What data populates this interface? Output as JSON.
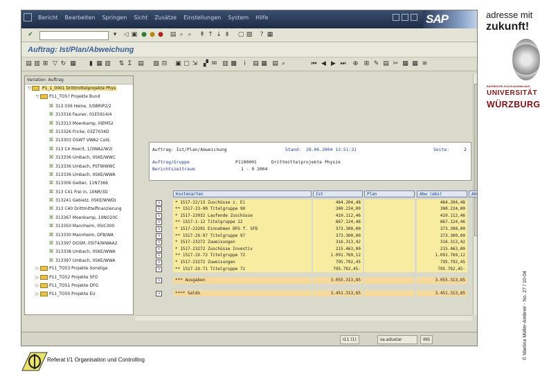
{
  "menu": {
    "items": [
      "Bericht",
      "Bearbeiten",
      "Springen",
      "Sicht",
      "Zusätze",
      "Einstellungen",
      "System",
      "Hilfe"
    ],
    "brand": "SAP"
  },
  "title": "Auftrag: Ist/Plan/Abweichung",
  "tree": {
    "header": "Variation: Auftrag",
    "rows": [
      {
        "indent": 0,
        "tw": "▽",
        "kind": "folder",
        "text": "P1_1_0001 Drittmittelprojekte Phys",
        "selected": true
      },
      {
        "indent": 1,
        "tw": "▽",
        "kind": "folder",
        "text": "P11_TO5? Projekte Bund",
        "selected": false
      },
      {
        "indent": 2,
        "tw": "",
        "kind": "leaf",
        "text": "313 036 Heine, 3/SBRIP2/2",
        "selected": false
      },
      {
        "indent": 2,
        "tw": "",
        "kind": "leaf",
        "text": "313316 Fauner, 01E5914/4",
        "selected": false
      },
      {
        "indent": 2,
        "tw": "",
        "kind": "leaf",
        "text": "313313 Moenkamp, 0IEM52",
        "selected": false
      },
      {
        "indent": 2,
        "tw": "",
        "kind": "leaf",
        "text": "313326 Fricke, 03Z7034D",
        "selected": false
      },
      {
        "indent": 2,
        "tw": "",
        "kind": "leaf",
        "text": "313303 OSWT VWA2 Cold,",
        "selected": false
      },
      {
        "indent": 2,
        "tw": "",
        "kind": "leaf",
        "text": "313 C4 Hoer/t, 1/3WA2/W2I",
        "selected": false
      },
      {
        "indent": 2,
        "tw": "",
        "kind": "leaf",
        "text": "313336 Umbach, 0SKE/WWC",
        "selected": false
      },
      {
        "indent": 2,
        "tw": "",
        "kind": "leaf",
        "text": "313336 Umbach, PSTWWWC",
        "selected": false
      },
      {
        "indent": 2,
        "tw": "",
        "kind": "leaf",
        "text": "313336 Umbach, 0SKE/WWA",
        "selected": false
      },
      {
        "indent": 2,
        "tw": "",
        "kind": "leaf",
        "text": "313306 Geiber, 11N7366",
        "selected": false
      },
      {
        "indent": 2,
        "tw": "",
        "kind": "leaf",
        "text": "313 C41 Frei in, 10NR/3D",
        "selected": false
      },
      {
        "indent": 2,
        "tw": "",
        "kind": "leaf",
        "text": "313241 Gebietz, 0SKE/WWDI",
        "selected": false
      },
      {
        "indent": 2,
        "tw": "",
        "kind": "leaf",
        "text": "313 C40 Drittmittelfinanzierung",
        "selected": false
      },
      {
        "indent": 2,
        "tw": "",
        "kind": "leaf",
        "text": "313367 Moenkamp, 10NO20C",
        "selected": false
      },
      {
        "indent": 2,
        "tw": "",
        "kind": "leaf",
        "text": "313350 Mannheim, 05IC300",
        "selected": false
      },
      {
        "indent": 2,
        "tw": "",
        "kind": "leaf",
        "text": "313330 Mannheim, DFB/WA",
        "selected": false
      },
      {
        "indent": 2,
        "tw": "",
        "kind": "leaf",
        "text": "313397 DGSM, 0SIT4/WWAA2",
        "selected": false
      },
      {
        "indent": 2,
        "tw": "",
        "kind": "leaf",
        "text": "313338 Umbach, 0SKE/WWA",
        "selected": false
      },
      {
        "indent": 2,
        "tw": "",
        "kind": "leaf",
        "text": "313397 Umbach, 0SKE/WWA",
        "selected": false
      },
      {
        "indent": 1,
        "tw": "▷",
        "kind": "folder",
        "text": "P11_TO53 Projekte Sonstige",
        "selected": false
      },
      {
        "indent": 1,
        "tw": "▷",
        "kind": "folder",
        "text": "P11_TO52 Projekte SFO",
        "selected": false
      },
      {
        "indent": 1,
        "tw": "▷",
        "kind": "folder",
        "text": "P11_TO51 Projekte DFG",
        "selected": false
      },
      {
        "indent": 1,
        "tw": "▷",
        "kind": "folder",
        "text": "P11_TO50 Projekte EU",
        "selected": false
      }
    ]
  },
  "report": {
    "header_title": "Auftrag: Ist/Plan/Abweichung",
    "stand_label": "Stand:",
    "stand_value": "28.06.2004 13:51:31",
    "seite_label": "Seite:",
    "seite_value": "2",
    "auftragsgruppe_label": "Auftrag/Gruppe",
    "auftragsgruppe_value": "P1100001",
    "auftragsgruppe_desc": "Drittmittelprojekte Physik",
    "berichtszeitraum_label": "Berichtszeitraum",
    "berichtszeitraum_value": "1 - 9 2004",
    "columns": [
      "Kostenarten",
      "Ist",
      "Plan",
      "Abw (abs)",
      "Abw"
    ],
    "rows": [
      {
        "kostenart": "*     1517-22/13 Zuschüsse z. Ei",
        "ist": "464.204,48",
        "plan": "",
        "abw": "464.204,48"
      },
      {
        "kostenart": "**       1517-23-90 Titelgruppe 90",
        "ist": "300.224,00",
        "plan": "",
        "abw": "300.224,00"
      },
      {
        "kostenart": "*     1517-23932 Laufende Zuschüsse",
        "ist": "410.112,46",
        "plan": "",
        "abw": "410.112,46"
      },
      {
        "kostenart": "**       1517-1-12 Titelgruppe 12",
        "ist": "867.124,46",
        "plan": "",
        "abw": "867.124,46"
      },
      {
        "kostenart": "*     1517-23291 Einnahmen DFG f. SFD",
        "ist": "373.300,00",
        "plan": "",
        "abw": "373.300,00"
      },
      {
        "kostenart": "**       1517-2X-97 Titelgruppe 97",
        "ist": "373.300,00",
        "plan": "",
        "abw": "373.300,00"
      },
      {
        "kostenart": "*     1517-23272 Zuweisungen",
        "ist": "316.313,42",
        "plan": "",
        "abw": "316.313,42"
      },
      {
        "kostenart": "*     1517-23272 Zuschüsse Investiv",
        "ist": "215.463,00",
        "plan": "",
        "abw": "215.463,00"
      },
      {
        "kostenart": "**       1517-2X-72 Titelgruppe 72",
        "ist": "1.091.769,12",
        "plan": "",
        "abw": "1.091.769,12"
      },
      {
        "kostenart": "*     1517-23272 Zuweisungen",
        "ist": "795.792,45",
        "plan": "",
        "abw": "795.792,45"
      },
      {
        "kostenart": "**       1517-2X-71 Titelgruppe 71",
        "ist": "795.792,45-",
        "plan": "",
        "abw": "795.792,45-"
      }
    ],
    "totals": [
      {
        "kostenart": "***      Ausgaben",
        "ist": "3.055.313,85",
        "plan": "",
        "abw": "3.055.313,85"
      },
      {
        "kostenart": "****     Saldo",
        "ist": "3.451.313,85",
        "plan": "",
        "abw": "3.451.313,85"
      }
    ]
  },
  "statusbar": {
    "system": "I11 (1)",
    "server": "sa.adustar",
    "mode": "INS"
  },
  "footer": {
    "text": "Referat I/1 Organisation und Controlling"
  },
  "branding": {
    "line1": "adresse mit",
    "line2": "zukunft!",
    "uni_small": "BAYERISCHE JULIUS-MAXIMILIANS-",
    "uni_1": "UNIVERSITÄT",
    "uni_2": "WÜRZBURG",
    "copyright": "© Martina Müller-Ambner - No. 27 / 10-04"
  }
}
